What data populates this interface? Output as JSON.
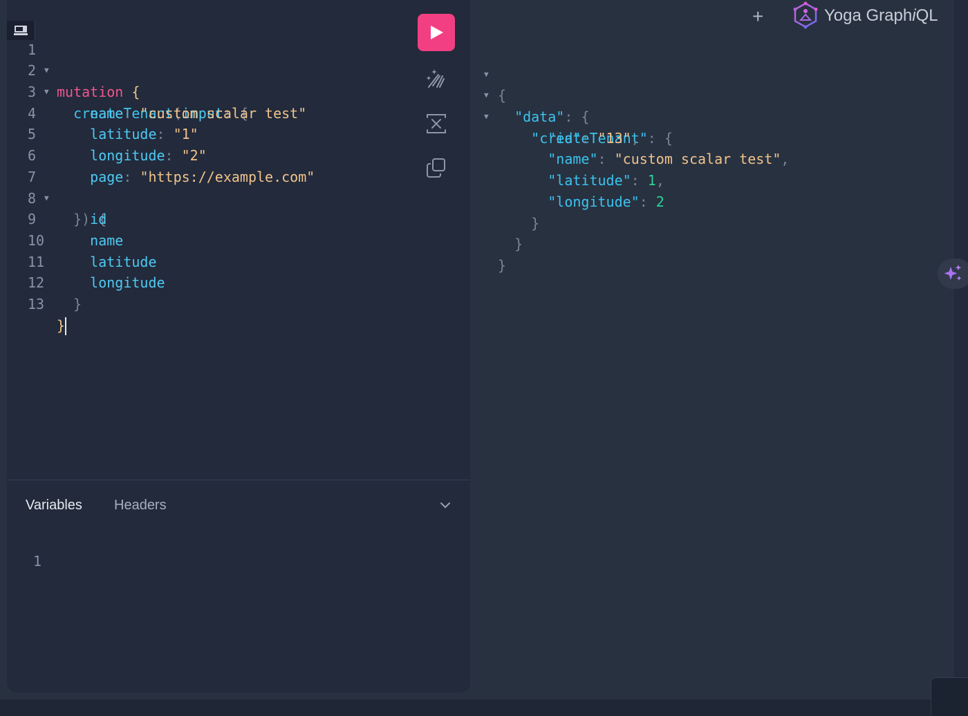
{
  "editor": {
    "lines": [
      {
        "n": "1",
        "fold": true
      },
      {
        "n": "2",
        "fold": true
      },
      {
        "n": "3",
        "fold": false
      },
      {
        "n": "4",
        "fold": false
      },
      {
        "n": "5",
        "fold": false
      },
      {
        "n": "6",
        "fold": false
      },
      {
        "n": "7",
        "fold": true
      },
      {
        "n": "8",
        "fold": false
      },
      {
        "n": "9",
        "fold": false
      },
      {
        "n": "10",
        "fold": false
      },
      {
        "n": "11",
        "fold": false
      },
      {
        "n": "12",
        "fold": false
      },
      {
        "n": "13",
        "fold": false
      }
    ],
    "tokens": {
      "mutation": "mutation",
      "open_brace": "{",
      "createTenant": "createTenant",
      "open_paren": "(",
      "input": "input",
      "colon": ":",
      "name_arg": "name",
      "name_val": "\"custom scalar test\"",
      "latitude_arg": "latitude",
      "latitude_val": "\"1\"",
      "longitude_arg": "longitude",
      "longitude_val": "\"2\"",
      "page_arg": "page",
      "page_val": "\"https://example.com\"",
      "close_args": "})",
      "field_id": "id",
      "field_name": "name",
      "field_latitude": "latitude",
      "field_longitude": "longitude",
      "close_brace": "}"
    }
  },
  "tabs": {
    "variables": "Variables",
    "headers": "Headers"
  },
  "variables_editor": {
    "line_number": "1"
  },
  "result": {
    "open": "{",
    "data_key": "\"data\"",
    "createTenant_key": "\"createTenant\"",
    "id_key": "\"id\"",
    "id_val": "\"13\"",
    "name_key": "\"name\"",
    "name_val": "\"custom scalar test\"",
    "latitude_key": "\"latitude\"",
    "latitude_val": "1",
    "longitude_key": "\"longitude\"",
    "longitude_val": "2",
    "close": "}",
    "colon": ": ",
    "comma": ","
  },
  "header": {
    "add_tab": "+",
    "logo_prefix": "Yoga Graph",
    "logo_italic": "i",
    "logo_suffix": "QL"
  },
  "colors": {
    "run_button": "#f23f83",
    "keyword": "#f0568f",
    "string": "#f2c38c",
    "number": "#2ad396",
    "field": "#4fc9f2"
  }
}
